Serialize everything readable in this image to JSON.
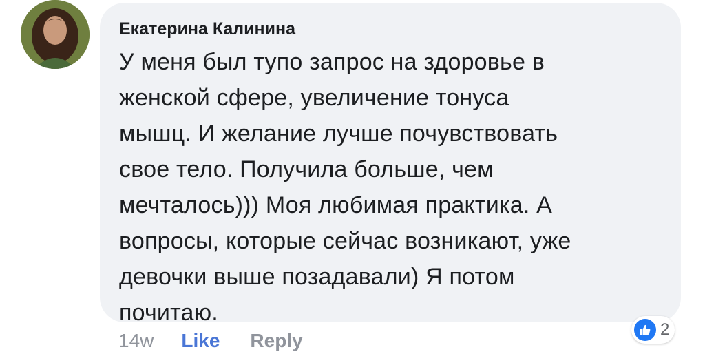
{
  "comment": {
    "author": "Екатерина Калинина",
    "text_lines": [
      "У меня был тупо запрос на здоровье в",
      "женской сфере, увеличение тонуса",
      "мышц. И желание лучше почувствовать",
      "свое тело. Получила больше, чем",
      "мечталось))) Моя любимая практика. А",
      "вопросы, которые сейчас возникают, уже",
      "девочки выше позадавали) Я потом",
      "почитаю."
    ],
    "timestamp": "14w",
    "like_label": "Like",
    "reply_label": "Reply",
    "reaction_count": "2",
    "reaction_icon": "thumbs-up-icon"
  },
  "colors": {
    "bubble_bg": "#f0f2f5",
    "like_accent": "#4a76d6",
    "reaction_blue": "#2078f4",
    "muted": "#90949c"
  }
}
